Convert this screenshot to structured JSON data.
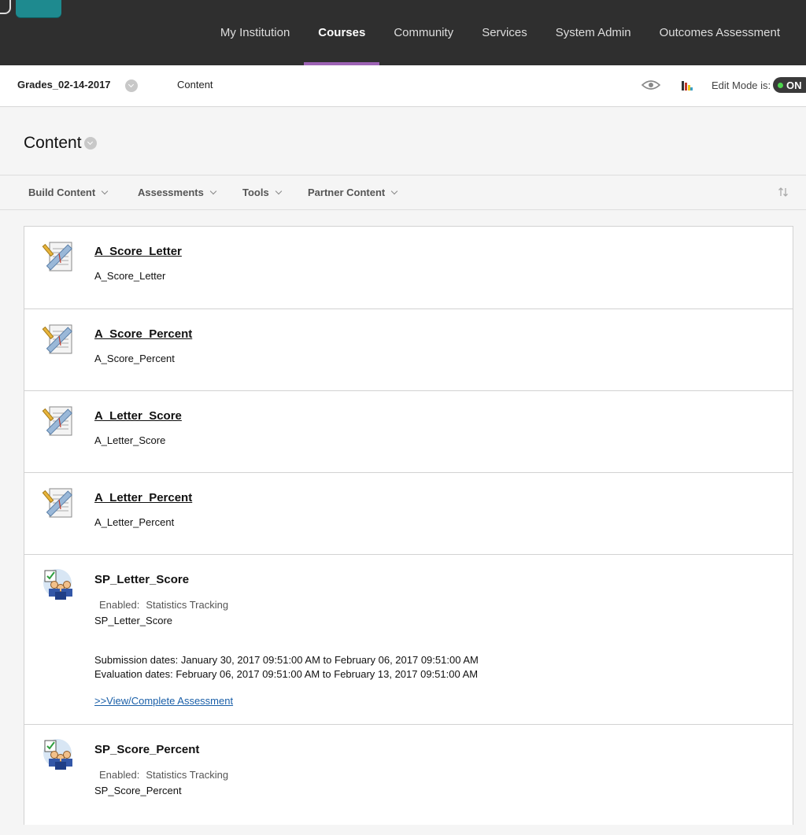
{
  "nav": {
    "items": [
      {
        "label": "My Institution",
        "active": false
      },
      {
        "label": "Courses",
        "active": true
      },
      {
        "label": "Community",
        "active": false
      },
      {
        "label": "Services",
        "active": false
      },
      {
        "label": "System Admin",
        "active": false
      },
      {
        "label": "Outcomes Assessment",
        "active": false
      }
    ]
  },
  "breadcrumb": {
    "course": "Grades_02-14-2017",
    "current": "Content"
  },
  "edit_mode": {
    "label": "Edit Mode is:",
    "state": "ON"
  },
  "page": {
    "title": "Content"
  },
  "actions": [
    {
      "label": "Build Content"
    },
    {
      "label": "Assessments"
    },
    {
      "label": "Tools"
    },
    {
      "label": "Partner Content"
    }
  ],
  "items": [
    {
      "title": "A_Score_Letter",
      "desc": "A_Score_Letter",
      "icon": "assignment-icon"
    },
    {
      "title": "A_Score_Percent",
      "desc": "A_Score_Percent",
      "icon": "assignment-icon"
    },
    {
      "title": "A_Letter_Score",
      "desc": "A_Letter_Score",
      "icon": "assignment-icon"
    },
    {
      "title": "A_Letter_Percent",
      "desc": "A_Letter_Percent",
      "icon": "assignment-icon"
    },
    {
      "title": "SP_Letter_Score",
      "enabled_label": "Enabled:",
      "enabled_value": "Statistics Tracking",
      "desc": "SP_Letter_Score",
      "submission": "Submission dates: January 30, 2017 09:51:00 AM to February 06, 2017 09:51:00 AM",
      "evaluation": "Evaluation dates: February 06, 2017 09:51:00 AM to February 13, 2017 09:51:00 AM",
      "link": ">>View/Complete Assessment",
      "icon": "self-peer-assessment-icon"
    },
    {
      "title": "SP_Score_Percent",
      "enabled_label": "Enabled:",
      "enabled_value": "Statistics Tracking",
      "desc": "SP_Score_Percent",
      "icon": "self-peer-assessment-icon"
    }
  ]
}
